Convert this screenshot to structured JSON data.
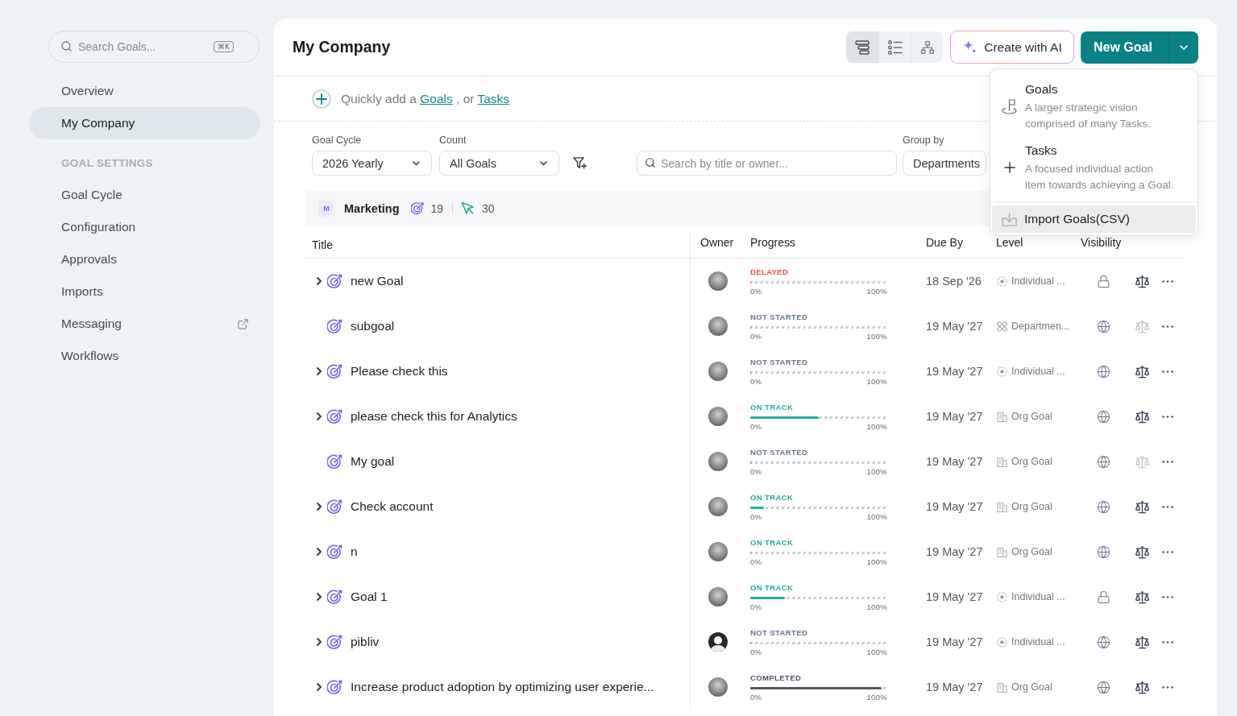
{
  "sidebar": {
    "search": {
      "placeholder": "Search Goals...",
      "shortcut": "⌘K"
    },
    "items": [
      {
        "label": "Overview",
        "selected": false,
        "external": false
      },
      {
        "label": "My Company",
        "selected": true,
        "external": false
      }
    ],
    "settings": {
      "heading": "GOAL SETTINGS",
      "items": [
        {
          "label": "Goal Cycle",
          "selected": false,
          "external": false
        },
        {
          "label": "Configuration",
          "selected": false,
          "external": false
        },
        {
          "label": "Approvals",
          "selected": false,
          "external": false
        },
        {
          "label": "Imports",
          "selected": false,
          "external": false
        },
        {
          "label": "Messaging",
          "selected": false,
          "external": true
        },
        {
          "label": "Workflows",
          "selected": false,
          "external": false
        }
      ]
    }
  },
  "header": {
    "title": "My Company",
    "views": [
      {
        "kind": "stack",
        "selected": true
      },
      {
        "kind": "list",
        "selected": false
      },
      {
        "kind": "tree",
        "selected": false
      }
    ],
    "ai_button": "Create with AI",
    "new_button": "New Goal"
  },
  "new_menu": {
    "options": [
      {
        "kind": "goal",
        "title": "Goals",
        "description": "A larger strategic vision comprised of many Tasks."
      },
      {
        "kind": "task",
        "title": "Tasks",
        "description": "A focused individual action item towards achieving a Goal."
      }
    ],
    "import": {
      "label": "Import Goals(CSV)",
      "highlighted": true
    }
  },
  "quick_add": {
    "prefix": "Quickly add a",
    "links": [
      "Goals",
      "Tasks"
    ],
    "joiner": ", or"
  },
  "filters": [
    {
      "label": "Goal Cycle",
      "value": "2026 Yearly"
    },
    {
      "label": "Count",
      "value": "All Goals"
    }
  ],
  "search": {
    "placeholder": "Search by title or owner..."
  },
  "group_by": {
    "label": "Group by",
    "value": "Departments"
  },
  "group": {
    "badge": "M",
    "name": "Marketing",
    "goal_count": "19",
    "task_count": "30"
  },
  "table": {
    "columns": [
      "Title",
      "Owner",
      "Progress",
      "Due By",
      "Level",
      "Visibility"
    ],
    "rows": [
      {
        "title": "new Goal",
        "has_children": true,
        "avatar": {
          "kind": "photo"
        },
        "status": {
          "kind": "delayed",
          "label": "DELAYED"
        },
        "level": 0,
        "range_start": "0%",
        "range_end": "100%",
        "due": "18 Sep '26",
        "tier": {
          "kind": "individual",
          "label": "Individual ..."
        },
        "private": true,
        "weighted": true
      },
      {
        "title": "subgoal",
        "has_children": false,
        "avatar": {
          "kind": "photo"
        },
        "status": {
          "kind": "not_started",
          "label": "NOT STARTED"
        },
        "level": 0,
        "range_start": "0%",
        "range_end": "100%",
        "due": "19 May '27",
        "tier": {
          "kind": "department",
          "label": "Departmen..."
        },
        "private": false,
        "weighted": false
      },
      {
        "title": "Please check this",
        "has_children": true,
        "avatar": {
          "kind": "photo"
        },
        "status": {
          "kind": "not_started",
          "label": "NOT STARTED"
        },
        "level": 0,
        "range_start": "0%",
        "range_end": "100%",
        "due": "19 May '27",
        "tier": {
          "kind": "individual",
          "label": "Individual ..."
        },
        "private": false,
        "weighted": true
      },
      {
        "title": "please check this for Analytics",
        "has_children": true,
        "avatar": {
          "kind": "photo"
        },
        "status": {
          "kind": "on_track",
          "label": "ON TRACK"
        },
        "level": 0.5,
        "range_start": "0%",
        "range_end": "100%",
        "due": "19 May '27",
        "tier": {
          "kind": "org",
          "label": "Org Goal"
        },
        "private": false,
        "weighted": true
      },
      {
        "title": "My goal",
        "has_children": false,
        "avatar": {
          "kind": "photo"
        },
        "status": {
          "kind": "not_started",
          "label": "NOT STARTED"
        },
        "level": 0,
        "range_start": "0%",
        "range_end": "100%",
        "due": "19 May '27",
        "tier": {
          "kind": "org",
          "label": "Org Goal"
        },
        "private": false,
        "weighted": false
      },
      {
        "title": "Check account",
        "has_children": true,
        "avatar": {
          "kind": "photo"
        },
        "status": {
          "kind": "on_track",
          "label": "ON TRACK"
        },
        "level": 0.1,
        "range_start": "0%",
        "range_end": "100%",
        "due": "19 May '27",
        "tier": {
          "kind": "org",
          "label": "Org Goal"
        },
        "private": false,
        "weighted": true
      },
      {
        "title": "n",
        "has_children": true,
        "avatar": {
          "kind": "photo"
        },
        "status": {
          "kind": "on_track",
          "label": "ON TRACK"
        },
        "level": 0,
        "range_start": "0%",
        "range_end": "100%",
        "due": "19 May '27",
        "tier": {
          "kind": "org",
          "label": "Org Goal"
        },
        "private": false,
        "weighted": true
      },
      {
        "title": "Goal 1",
        "has_children": true,
        "avatar": {
          "kind": "photo"
        },
        "status": {
          "kind": "on_track",
          "label": "ON TRACK"
        },
        "level": 0.25,
        "range_start": "0%",
        "range_end": "100%",
        "due": "19 May '27",
        "tier": {
          "kind": "individual",
          "label": "Individual ..."
        },
        "private": true,
        "weighted": true
      },
      {
        "title": "pibliv",
        "has_children": true,
        "avatar": {
          "kind": "generic"
        },
        "status": {
          "kind": "not_started",
          "label": "NOT STARTED"
        },
        "level": 0,
        "range_start": "0%",
        "range_end": "100%",
        "due": "19 May '27",
        "tier": {
          "kind": "individual",
          "label": "Individual ..."
        },
        "private": false,
        "weighted": true
      },
      {
        "title": "Increase product adoption by optimizing user experie...",
        "has_children": true,
        "avatar": {
          "kind": "photo"
        },
        "status": {
          "kind": "completed",
          "label": "COMPLETED"
        },
        "level": 0.96,
        "range_start": "0%",
        "range_end": "100%",
        "due": "19 May '27",
        "tier": {
          "kind": "org",
          "label": "Org Goal"
        },
        "private": false,
        "weighted": true
      }
    ]
  }
}
